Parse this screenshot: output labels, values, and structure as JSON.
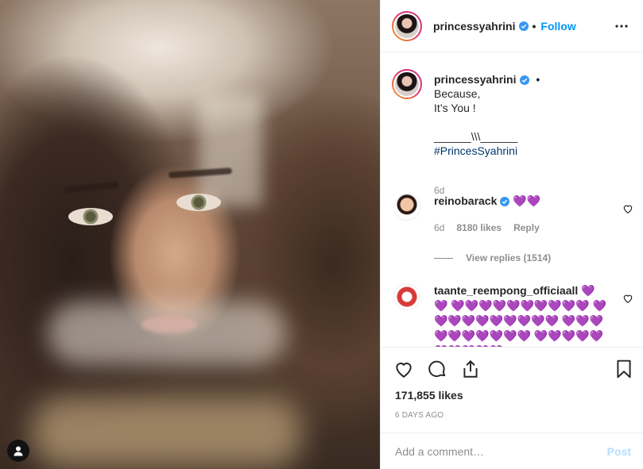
{
  "post": {
    "author": "princessyahrini",
    "separator": "•",
    "follow_label": "Follow",
    "more_icon": "more-horizontal-icon"
  },
  "caption": {
    "username": "princessyahrini",
    "separator": "•",
    "lines": [
      "Because,",
      "It’s You !"
    ],
    "divider": "______\\\\\\______",
    "hashtag": "#PrincesSyahrini",
    "time": "6d"
  },
  "comments": [
    {
      "username": "reinobarack",
      "text": "💜💜",
      "time": "6d",
      "likes": "8180 likes",
      "reply_label": "Reply",
      "view_replies": "View replies (1514)"
    },
    {
      "username": "taante_reempong_officiaall",
      "text": "💜💜 💜💜💜💜💜💜💜💜💜💜 💜💜💜💜💜💜💜💜💜💜 💜💜💜💜💜💜💜💜💜💜 💜💜💜💜💜💜💜💜💜💜"
    }
  ],
  "actions": {
    "likes": "171,855 likes",
    "date": "6 DAYS AGO"
  },
  "add_comment": {
    "placeholder": "Add a comment…",
    "post_label": "Post"
  },
  "colors": {
    "accent": "#0095f6",
    "hashtag": "#00376b",
    "muted": "#8e8e8e",
    "post_disabled": "#b2dffc"
  }
}
